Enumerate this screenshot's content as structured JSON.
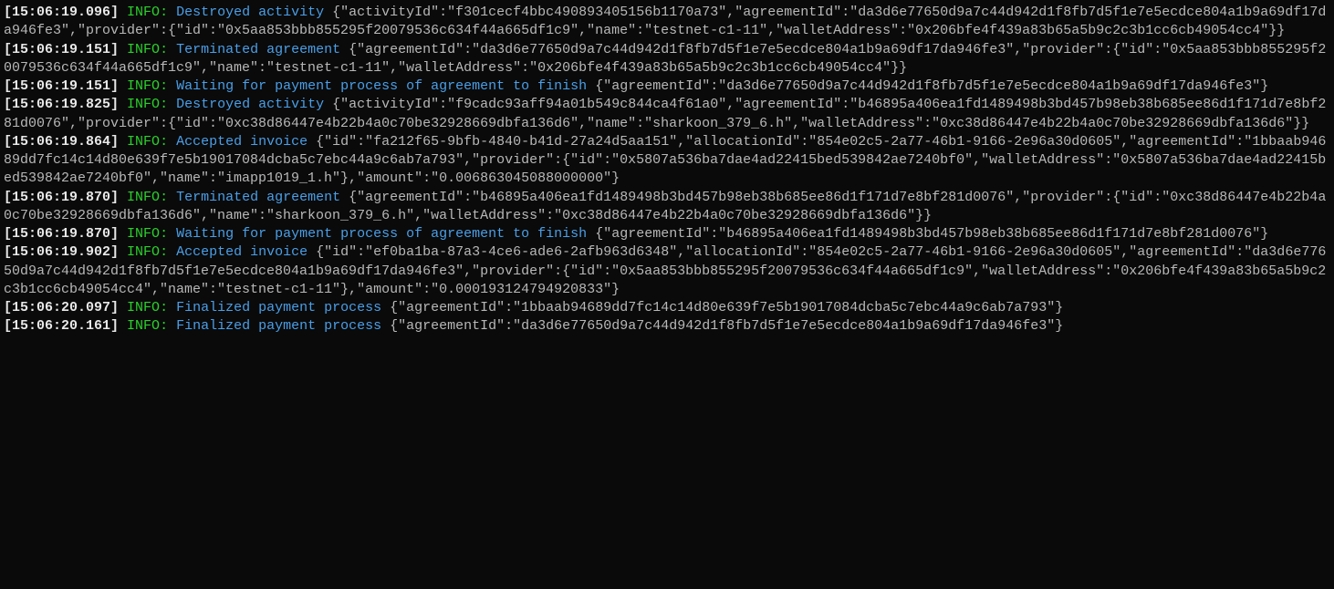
{
  "logs": [
    {
      "timestamp": "[15:06:19.096]",
      "level": "INFO",
      "message": "Destroyed activity",
      "payload": "{\"activityId\":\"f301cecf4bbc490893405156b1170a73\",\"agreementId\":\"da3d6e77650d9a7c44d942d1f8fb7d5f1e7e5ecdce804a1b9a69df17da946fe3\",\"provider\":{\"id\":\"0x5aa853bbb855295f20079536c634f44a665df1c9\",\"name\":\"testnet-c1-11\",\"walletAddress\":\"0x206bfe4f439a83b65a5b9c2c3b1cc6cb49054cc4\"}}"
    },
    {
      "timestamp": "[15:06:19.151]",
      "level": "INFO",
      "message": "Terminated agreement",
      "payload": "{\"agreementId\":\"da3d6e77650d9a7c44d942d1f8fb7d5f1e7e5ecdce804a1b9a69df17da946fe3\",\"provider\":{\"id\":\"0x5aa853bbb855295f20079536c634f44a665df1c9\",\"name\":\"testnet-c1-11\",\"walletAddress\":\"0x206bfe4f439a83b65a5b9c2c3b1cc6cb49054cc4\"}}"
    },
    {
      "timestamp": "[15:06:19.151]",
      "level": "INFO",
      "message": "Waiting for payment process of agreement to finish",
      "payload": "{\"agreementId\":\"da3d6e77650d9a7c44d942d1f8fb7d5f1e7e5ecdce804a1b9a69df17da946fe3\"}"
    },
    {
      "timestamp": "[15:06:19.825]",
      "level": "INFO",
      "message": "Destroyed activity",
      "payload": "{\"activityId\":\"f9cadc93aff94a01b549c844ca4f61a0\",\"agreementId\":\"b46895a406ea1fd1489498b3bd457b98eb38b685ee86d1f171d7e8bf281d0076\",\"provider\":{\"id\":\"0xc38d86447e4b22b4a0c70be32928669dbfa136d6\",\"name\":\"sharkoon_379_6.h\",\"walletAddress\":\"0xc38d86447e4b22b4a0c70be32928669dbfa136d6\"}}"
    },
    {
      "timestamp": "[15:06:19.864]",
      "level": "INFO",
      "message": "Accepted invoice",
      "payload": "{\"id\":\"fa212f65-9bfb-4840-b41d-27a24d5aa151\",\"allocationId\":\"854e02c5-2a77-46b1-9166-2e96a30d0605\",\"agreementId\":\"1bbaab94689dd7fc14c14d80e639f7e5b19017084dcba5c7ebc44a9c6ab7a793\",\"provider\":{\"id\":\"0x5807a536ba7dae4ad22415bed539842ae7240bf0\",\"walletAddress\":\"0x5807a536ba7dae4ad22415bed539842ae7240bf0\",\"name\":\"imapp1019_1.h\"},\"amount\":\"0.006863045088000000\"}"
    },
    {
      "timestamp": "[15:06:19.870]",
      "level": "INFO",
      "message": "Terminated agreement",
      "payload": "{\"agreementId\":\"b46895a406ea1fd1489498b3bd457b98eb38b685ee86d1f171d7e8bf281d0076\",\"provider\":{\"id\":\"0xc38d86447e4b22b4a0c70be32928669dbfa136d6\",\"name\":\"sharkoon_379_6.h\",\"walletAddress\":\"0xc38d86447e4b22b4a0c70be32928669dbfa136d6\"}}"
    },
    {
      "timestamp": "[15:06:19.870]",
      "level": "INFO",
      "message": "Waiting for payment process of agreement to finish",
      "payload": "{\"agreementId\":\"b46895a406ea1fd1489498b3bd457b98eb38b685ee86d1f171d7e8bf281d0076\"}"
    },
    {
      "timestamp": "[15:06:19.902]",
      "level": "INFO",
      "message": "Accepted invoice",
      "payload": "{\"id\":\"ef0ba1ba-87a3-4ce6-ade6-2afb963d6348\",\"allocationId\":\"854e02c5-2a77-46b1-9166-2e96a30d0605\",\"agreementId\":\"da3d6e77650d9a7c44d942d1f8fb7d5f1e7e5ecdce804a1b9a69df17da946fe3\",\"provider\":{\"id\":\"0x5aa853bbb855295f20079536c634f44a665df1c9\",\"walletAddress\":\"0x206bfe4f439a83b65a5b9c2c3b1cc6cb49054cc4\",\"name\":\"testnet-c1-11\"},\"amount\":\"0.000193124794920833\"}"
    },
    {
      "timestamp": "[15:06:20.097]",
      "level": "INFO",
      "message": "Finalized payment process",
      "payload": "{\"agreementId\":\"1bbaab94689dd7fc14c14d80e639f7e5b19017084dcba5c7ebc44a9c6ab7a793\"}"
    },
    {
      "timestamp": "[15:06:20.161]",
      "level": "INFO",
      "message": "Finalized payment process",
      "payload": "{\"agreementId\":\"da3d6e77650d9a7c44d942d1f8fb7d5f1e7e5ecdce804a1b9a69df17da946fe3\"}"
    }
  ]
}
